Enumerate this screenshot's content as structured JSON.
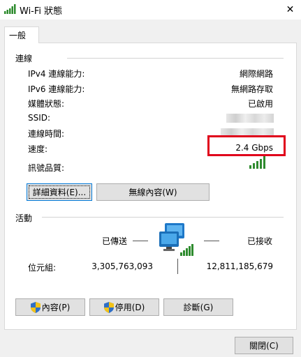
{
  "window": {
    "title": "Wi-Fi 狀態",
    "close_symbol": "✕"
  },
  "tab": {
    "label": "一般"
  },
  "connection": {
    "heading": "連線",
    "rows": [
      {
        "label": "IPv4 連線能力:",
        "value": "網際網路"
      },
      {
        "label": "IPv6 連線能力:",
        "value": "無網路存取"
      },
      {
        "label": "媒體狀態:",
        "value": "已啟用"
      },
      {
        "label": "SSID:",
        "value": ""
      },
      {
        "label": "連線時間:",
        "value": ""
      },
      {
        "label": "速度:",
        "value": "2.4 Gbps"
      },
      {
        "label": "訊號品質:",
        "value": ""
      }
    ],
    "signal_bars": 5,
    "highlight_color": "#e0001b",
    "signal_color": "#2e8b2e",
    "buttons": {
      "details": "詳細資料(E)...",
      "wireless": "無線內容(W)"
    }
  },
  "activity": {
    "heading": "活動",
    "sent_label": "已傳送",
    "received_label": "已接收",
    "bytes_label": "位元組:",
    "bytes_sent": "3,305,763,093",
    "bytes_received": "12,811,185,679",
    "icon": "network-computers-icon"
  },
  "actions": {
    "properties": "內容(P)",
    "disable": "停用(D)",
    "diagnose": "診斷(G)"
  },
  "footer": {
    "close": "關閉(C)"
  }
}
